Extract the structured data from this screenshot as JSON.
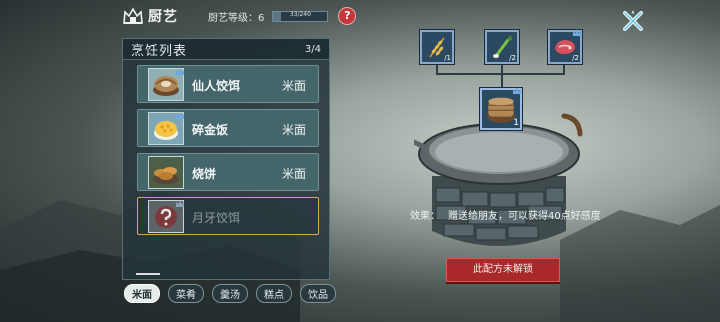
{
  "header": {
    "title": "厨艺",
    "level_label": "厨艺等级：6",
    "level_progress": "33/240",
    "level_fraction": 0.1375,
    "help_symbol": "?"
  },
  "recipe_panel": {
    "title": "烹饪列表",
    "page": "3/4",
    "recipes": [
      {
        "name": "仙人饺饵",
        "category": "米面",
        "locked": false
      },
      {
        "name": "碎金饭",
        "category": "米面",
        "locked": false
      },
      {
        "name": "烧饼",
        "category": "米面",
        "locked": false
      },
      {
        "name": "月牙饺饵",
        "category": "",
        "locked": true
      }
    ]
  },
  "tabs": [
    {
      "label": "米面",
      "active": true
    },
    {
      "label": "菜肴",
      "active": false
    },
    {
      "label": "羹汤",
      "active": false
    },
    {
      "label": "糕点",
      "active": false
    },
    {
      "label": "饮品",
      "active": false
    }
  ],
  "ingredients": [
    {
      "icon": "wheat-icon",
      "count": "/1"
    },
    {
      "icon": "scallion-icon",
      "count": "/2"
    },
    {
      "icon": "meat-icon",
      "count": "/2"
    }
  ],
  "result_dish": {
    "icon": "steamer-dumpling-icon",
    "count": "1"
  },
  "effect": {
    "label": "效果：",
    "text": "赠送给朋友，可以获得40点好感度"
  },
  "unlock_status": "此配方未解锁",
  "colors": {
    "accent_red": "#a8282b",
    "slot_blue": "#2b4a62",
    "selected_gold": "#d6a650"
  }
}
